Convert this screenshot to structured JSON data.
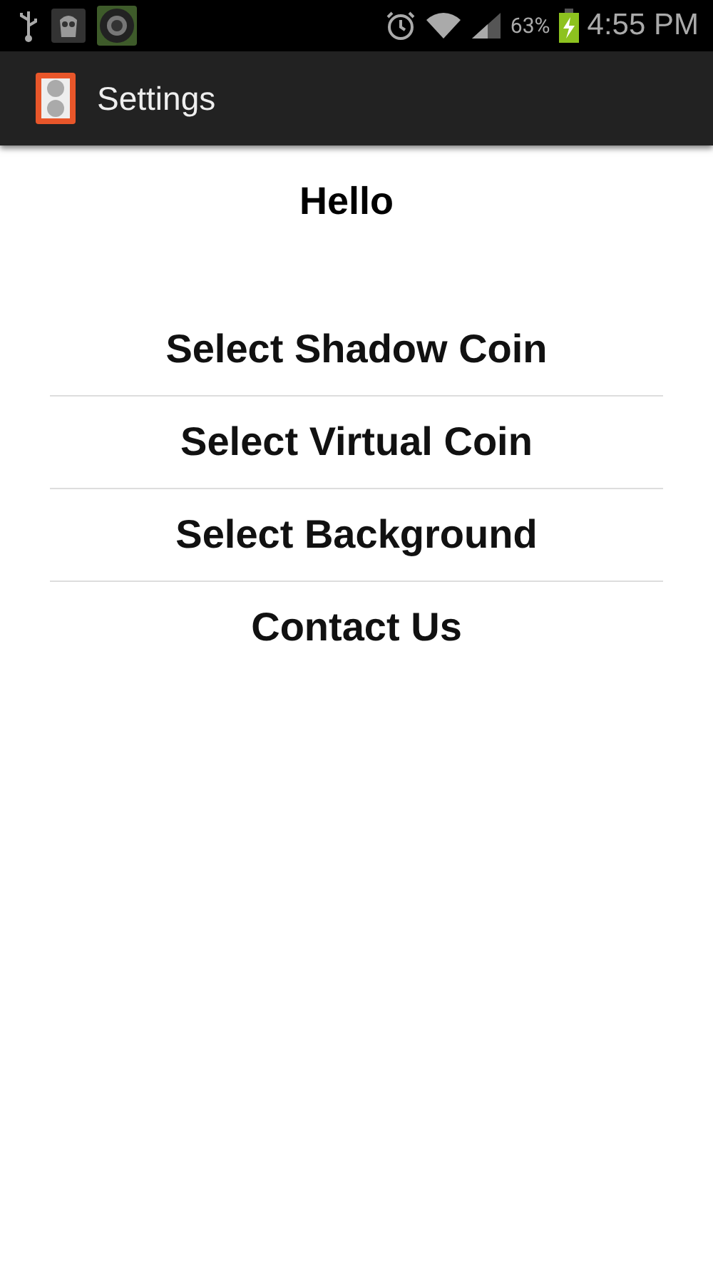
{
  "status_bar": {
    "battery_text": "63%",
    "time": "4:55 PM"
  },
  "app_bar": {
    "title": "Settings"
  },
  "heading": "Hello",
  "menu_items": [
    "Select Shadow Coin",
    "Select Virtual Coin",
    "Select Background",
    "Contact Us"
  ]
}
